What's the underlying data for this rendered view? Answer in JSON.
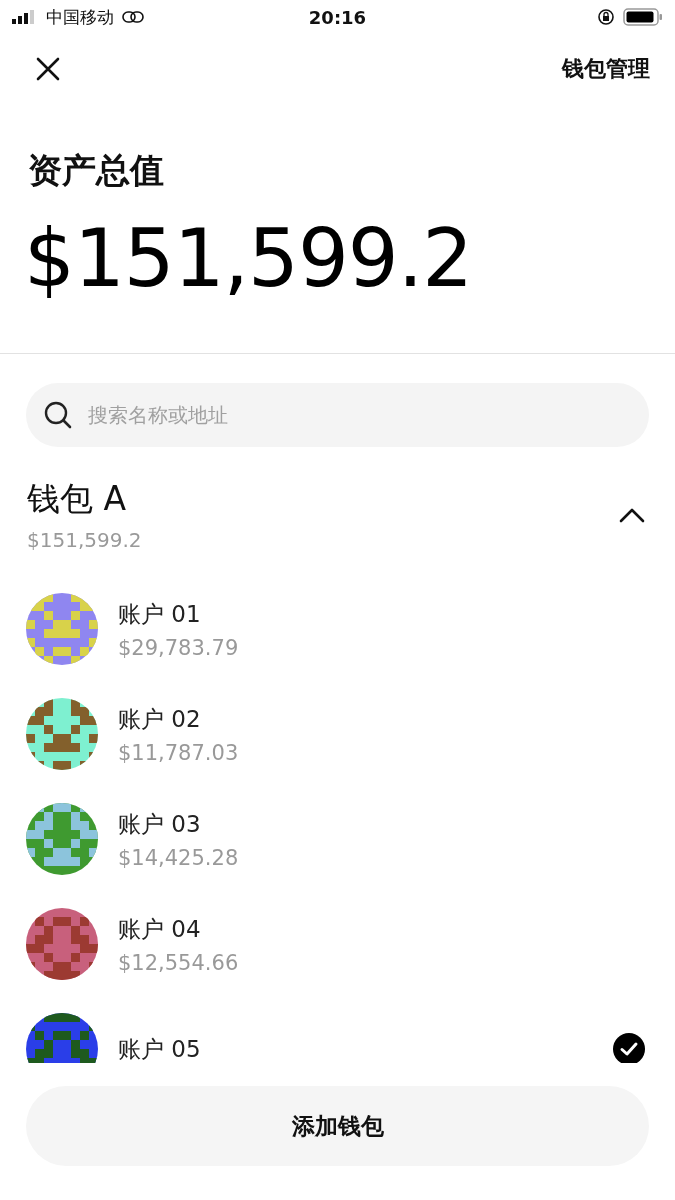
{
  "status_bar": {
    "carrier": "中国移动",
    "time": "20:16"
  },
  "header": {
    "action": "钱包管理"
  },
  "total": {
    "label": "资产总值",
    "value": "$151,599.2"
  },
  "search": {
    "placeholder": "搜索名称或地址"
  },
  "wallet": {
    "name": "钱包 A",
    "value": "$151,599.2",
    "expanded": true
  },
  "accounts": [
    {
      "name": "账户 01",
      "value": "$29,783.79",
      "color": "#8f86f0",
      "selected": false
    },
    {
      "name": "账户 02",
      "value": "$11,787.03",
      "color": "#7ef0d0",
      "selected": false
    },
    {
      "name": "账户 03",
      "value": "$14,425.28",
      "color": "#3f9a30",
      "selected": false
    },
    {
      "name": "账户 04",
      "value": "$12,554.66",
      "color": "#c8607c",
      "selected": false
    },
    {
      "name": "账户 05",
      "color": "#2a3ee8",
      "selected": true
    }
  ],
  "add_button": {
    "label": "添加钱包"
  }
}
